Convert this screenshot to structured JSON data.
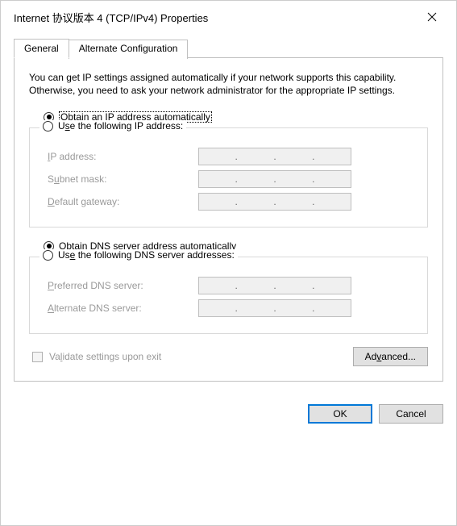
{
  "window": {
    "title": "Internet 协议版本 4 (TCP/IPv4) Properties"
  },
  "tabs": {
    "general": "General",
    "alternate": "Alternate Configuration"
  },
  "description": "You can get IP settings assigned automatically if your network supports this capability. Otherwise, you need to ask your network administrator for the appropriate IP settings.",
  "ip_section": {
    "auto_label": "Obtain an IP address automatically",
    "manual_label": "Use the following IP address:",
    "selection": "auto",
    "fields": {
      "ip_address_label": "IP address:",
      "subnet_mask_label": "Subnet mask:",
      "default_gateway_label": "Default gateway:",
      "ip_address_value": "",
      "subnet_mask_value": "",
      "default_gateway_value": ""
    }
  },
  "dns_section": {
    "auto_label": "Obtain DNS server address automatically",
    "manual_label": "Use the following DNS server addresses:",
    "selection": "auto",
    "fields": {
      "preferred_label": "Preferred DNS server:",
      "alternate_label": "Alternate DNS server:",
      "preferred_value": "",
      "alternate_value": ""
    }
  },
  "validate_checkbox": {
    "label": "Validate settings upon exit",
    "checked": false
  },
  "buttons": {
    "advanced": "Advanced...",
    "ok": "OK",
    "cancel": "Cancel"
  }
}
